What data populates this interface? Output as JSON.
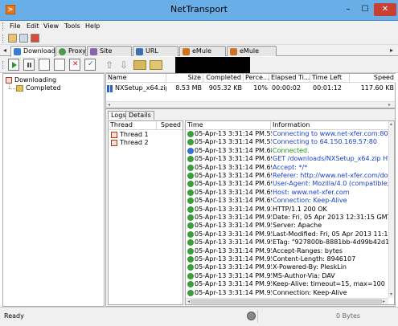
{
  "window": {
    "title": "NetTransport",
    "minimize_glyph": "–",
    "maximize_glyph": "☐",
    "close_glyph": "✕"
  },
  "menu": [
    "File",
    "Edit",
    "View",
    "Tools",
    "Help"
  ],
  "tabs": [
    {
      "label": "Download",
      "icon": "download-tab-icon",
      "color": "#3a7bd5"
    },
    {
      "label": "Proxy",
      "icon": "globe-icon",
      "color": "#4a9a4a"
    },
    {
      "label": "Site Explorer",
      "icon": "site-explorer-icon",
      "color": "#8866aa"
    },
    {
      "label": "URL Sniffer",
      "icon": "magnifier-icon",
      "color": "#3a6fb0"
    },
    {
      "label": "eMule Server",
      "icon": "emule-icon",
      "color": "#d07020"
    },
    {
      "label": "eMule Search",
      "icon": "emule-search-icon",
      "color": "#d07020"
    }
  ],
  "tree": {
    "root": "Downloading",
    "child": "Completed"
  },
  "download_list": {
    "columns": [
      "Name",
      "Size",
      "Completed",
      "Perce...",
      "Elapsed Ti...",
      "Time Left",
      "Speed"
    ],
    "rows": [
      {
        "name": "NXSetup_x64.zip",
        "size": "8.53 MB",
        "completed": "905.32 KB",
        "percent": "10%",
        "elapsed": "00:00:02",
        "left": "00:01:12",
        "speed": "117.60 KB"
      }
    ]
  },
  "subtabs": [
    "Logs",
    "Details"
  ],
  "threads": {
    "columns": [
      "Thread",
      "Speed"
    ],
    "items": [
      "Thread 1",
      "Thread 2"
    ]
  },
  "logs": {
    "columns": [
      "Time",
      "Information"
    ],
    "rows": [
      {
        "time": "05-Apr-13 3:31:14 PM.550",
        "info": "Connecting to www.net-xfer.com:80",
        "color": "#1a3fc8",
        "icon": "#3aa03a"
      },
      {
        "time": "05-Apr-13 3:31:14 PM.557",
        "info": "Connecting to 64.150.169.57:80",
        "color": "#1a3fc8",
        "icon": "#3aa03a"
      },
      {
        "time": "05-Apr-13 3:31:14 PM.689",
        "info": "Connected.",
        "color": "#1a9a1a",
        "icon": "#3a6fd0"
      },
      {
        "time": "05-Apr-13 3:31:14 PM.692",
        "info": "GET /downloads/NXSetup_x64.zip HTTP/",
        "color": "#1a3fc8",
        "icon": "#3aa03a"
      },
      {
        "time": "05-Apr-13 3:31:14 PM.694",
        "info": "Accept: */*",
        "color": "#1a3fc8",
        "icon": "#3aa03a"
      },
      {
        "time": "05-Apr-13 3:31:14 PM.694",
        "info": "Referer: http://www.net-xfer.com/downlo",
        "color": "#1a3fc8",
        "icon": "#3aa03a"
      },
      {
        "time": "05-Apr-13 3:31:14 PM.695",
        "info": "User-Agent: Mozilla/4.0 (compatible; MSI",
        "color": "#1a3fc8",
        "icon": "#3aa03a"
      },
      {
        "time": "05-Apr-13 3:31:14 PM.695",
        "info": "Host: www.net-xfer.com",
        "color": "#1a3fc8",
        "icon": "#3aa03a"
      },
      {
        "time": "05-Apr-13 3:31:14 PM.695",
        "info": "Connection: Keep-Alive",
        "color": "#1a3fc8",
        "icon": "#3aa03a"
      },
      {
        "time": "05-Apr-13 3:31:14 PM.929",
        "info": "HTTP/1.1 200 OK",
        "color": "#000000",
        "icon": "#3aa03a"
      },
      {
        "time": "05-Apr-13 3:31:14 PM.950",
        "info": "Date: Fri, 05 Apr 2013 12:31:15 GMT",
        "color": "#000000",
        "icon": "#3aa03a"
      },
      {
        "time": "05-Apr-13 3:31:14 PM.950",
        "info": "Server: Apache",
        "color": "#000000",
        "icon": "#3aa03a"
      },
      {
        "time": "05-Apr-13 3:31:14 PM.950",
        "info": "Last-Modified: Fri, 05 Apr 2013 11:19:31 G",
        "color": "#000000",
        "icon": "#3aa03a"
      },
      {
        "time": "05-Apr-13 3:31:14 PM.951",
        "info": "ETag: \"927800b-8881bb-4d99b42d116c0\"",
        "color": "#000000",
        "icon": "#3aa03a"
      },
      {
        "time": "05-Apr-13 3:31:14 PM.951",
        "info": "Accept-Ranges: bytes",
        "color": "#000000",
        "icon": "#3aa03a"
      },
      {
        "time": "05-Apr-13 3:31:14 PM.951",
        "info": "Content-Length: 8946107",
        "color": "#000000",
        "icon": "#3aa03a"
      },
      {
        "time": "05-Apr-13 3:31:14 PM.951",
        "info": "X-Powered-By: PleskLin",
        "color": "#000000",
        "icon": "#3aa03a"
      },
      {
        "time": "05-Apr-13 3:31:14 PM.951",
        "info": "MS-Author-Via: DAV",
        "color": "#000000",
        "icon": "#3aa03a"
      },
      {
        "time": "05-Apr-13 3:31:14 PM.952",
        "info": "Keep-Alive: timeout=15, max=100",
        "color": "#000000",
        "icon": "#3aa03a"
      },
      {
        "time": "05-Apr-13 3:31:14 PM.952",
        "info": "Connection: Keep-Alive",
        "color": "#000000",
        "icon": "#3aa03a"
      }
    ]
  },
  "status": {
    "left": "Ready",
    "right": "0 Bytes"
  }
}
